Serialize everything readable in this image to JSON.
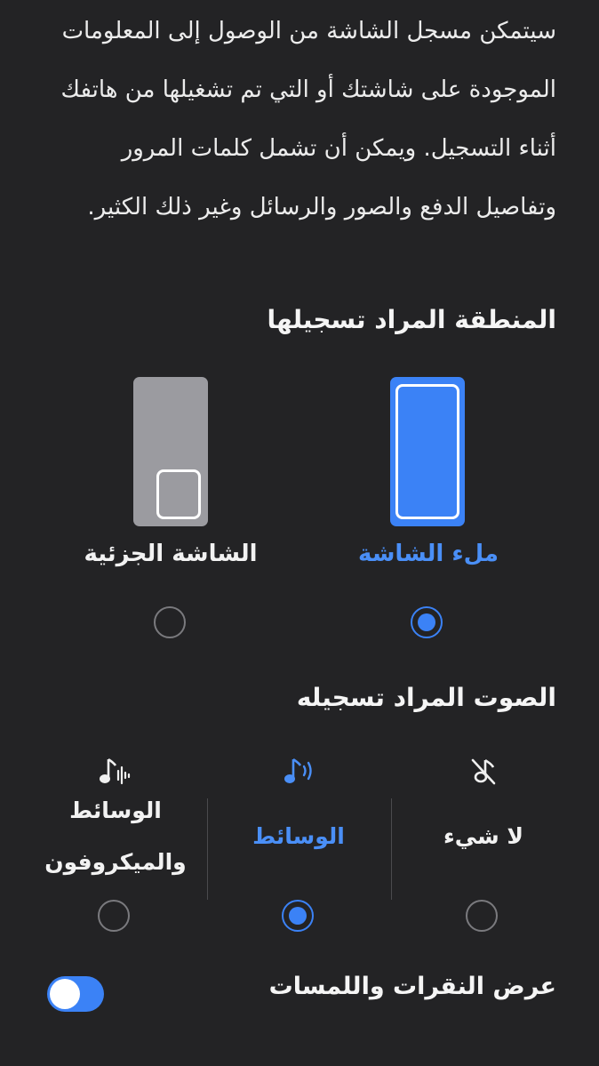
{
  "description": "سيتمكن مسجل الشاشة من الوصول إلى المعلومات الموجودة على شاشتك أو التي تم تشغيلها من هاتفك أثناء التسجيل. ويمكن أن تشمل كلمات المرور وتفاصيل الدفع والصور والرسائل وغير ذلك الكثير.",
  "area": {
    "heading": "المنطقة المراد تسجيلها",
    "options": [
      {
        "label": "ملء الشاشة",
        "selected": true
      },
      {
        "label": "الشاشة الجزئية",
        "selected": false
      }
    ]
  },
  "sound": {
    "heading": "الصوت المراد تسجيله",
    "options": [
      {
        "label": "لا شيء",
        "icon": "mute-note-icon",
        "selected": false
      },
      {
        "label": "الوسائط",
        "icon": "media-sound-icon",
        "selected": true
      },
      {
        "label": "الوسائط والميكروفون",
        "icon": "media-mic-icon",
        "selected": false
      }
    ]
  },
  "touches": {
    "label": "عرض النقرات واللمسات",
    "enabled": true
  },
  "colors": {
    "accent": "#3b82f6",
    "background": "#232325",
    "inactive": "#7a7a7e"
  }
}
